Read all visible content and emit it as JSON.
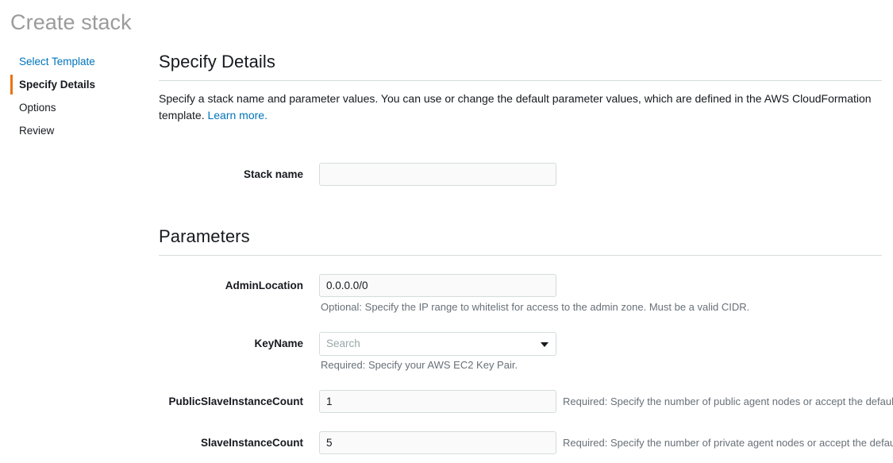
{
  "page": {
    "title": "Create stack"
  },
  "sidebar": {
    "items": [
      {
        "label": "Select Template",
        "state": "link"
      },
      {
        "label": "Specify Details",
        "state": "active"
      },
      {
        "label": "Options",
        "state": "normal"
      },
      {
        "label": "Review",
        "state": "normal"
      }
    ]
  },
  "main": {
    "section_title": "Specify Details",
    "intro_text": "Specify a stack name and parameter values. You can use or change the default parameter values, which are defined in the AWS CloudFormation template. ",
    "intro_link": "Learn more.",
    "stack_name": {
      "label": "Stack name",
      "value": "",
      "placeholder": ""
    },
    "parameters_title": "Parameters",
    "parameters": [
      {
        "label": "AdminLocation",
        "type": "text",
        "value": "0.0.0.0/0",
        "help": "Optional: Specify the IP range to whitelist for access to the admin zone. Must be a valid CIDR.",
        "help_position": "below"
      },
      {
        "label": "KeyName",
        "type": "select",
        "value": "Search",
        "help": "Required: Specify your AWS EC2 Key Pair.",
        "help_position": "below"
      },
      {
        "label": "PublicSlaveInstanceCount",
        "type": "text",
        "value": "1",
        "help": "Required: Specify the number of public agent nodes or accept the default.",
        "help_position": "right"
      },
      {
        "label": "SlaveInstanceCount",
        "type": "text",
        "value": "5",
        "help": "Required: Specify the number of private agent nodes or accept the default.",
        "help_position": "right"
      }
    ]
  },
  "colors": {
    "accent_orange": "#ec7211",
    "link_blue": "#0073bb",
    "text_dark": "#16191f",
    "text_muted": "#687078",
    "title_gray": "#9b9b9b",
    "border_gray": "#d5dbdb"
  }
}
